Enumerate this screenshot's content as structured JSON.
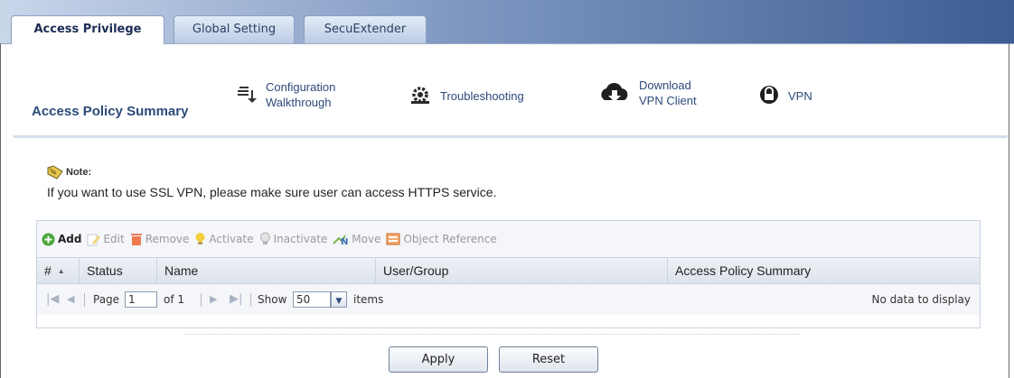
{
  "tabs": [
    {
      "label": "Access Privilege",
      "active": true
    },
    {
      "label": "Global Setting",
      "active": false
    },
    {
      "label": "SecuExtender",
      "active": false
    }
  ],
  "summary": {
    "title": "Access Policy Summary",
    "links": {
      "config_line1": "Configuration",
      "config_line2": "Walkthrough",
      "troubleshooting": "Troubleshooting",
      "download_line1": "Download",
      "download_line2": "VPN Client",
      "vpn": "VPN"
    }
  },
  "note": {
    "label": "Note:",
    "text": "If you want to use SSL VPN, please make sure user can access HTTPS service."
  },
  "toolbar": {
    "add": "Add",
    "edit": "Edit",
    "remove": "Remove",
    "activate": "Activate",
    "inactivate": "Inactivate",
    "move": "Move",
    "object_reference": "Object Reference"
  },
  "table": {
    "columns": [
      "#",
      "Status",
      "Name",
      "User/Group",
      "Access Policy Summary"
    ],
    "sort_indicator": "▲",
    "rows": []
  },
  "pager": {
    "page_label": "Page",
    "page_value": "1",
    "of_label": "of 1",
    "show_label": "Show",
    "show_value": "50",
    "items_label": "items",
    "empty_message": "No data to display"
  },
  "buttons": {
    "apply": "Apply",
    "reset": "Reset"
  },
  "colors": {
    "accent": "#2c4a7a",
    "tab_gradient_end": "#3d5d93"
  }
}
